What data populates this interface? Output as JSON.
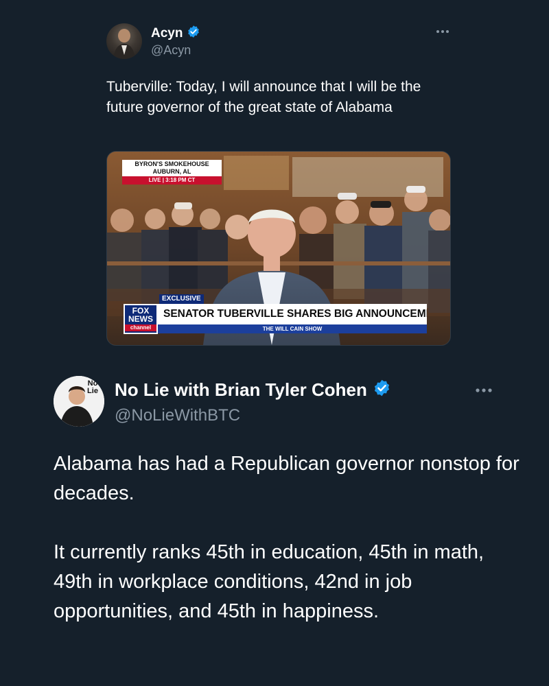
{
  "quoted_tweet": {
    "author_name": "Acyn",
    "author_handle": "@Acyn",
    "more_icon": "more-horizontal-icon",
    "verified_icon": "verified-badge-icon",
    "text": "Tuberville: Today, I will announce that I will be the future governor of the great state of Alabama",
    "media": {
      "location_line1": "BYRON'S SMOKEHOUSE",
      "location_line2": "AUBURN, AL",
      "live_label": "LIVE",
      "live_time": "3:18 PM CT",
      "exclusive_label": "EXCLUSIVE",
      "headline": "SENATOR TUBERVILLE SHARES BIG ANNOUNCEMENT",
      "show_name": "THE WILL CAIN SHOW",
      "network_logo_line1": "FOX",
      "network_logo_line2": "NEWS",
      "network_logo_line3": "channel"
    }
  },
  "main_tweet": {
    "author_name": "No Lie with Brian Tyler Cohen",
    "author_handle": "@NoLieWithBTC",
    "avatar_logo_line1": "No",
    "avatar_logo_line2": "Lie",
    "more_icon": "more-horizontal-icon",
    "verified_icon": "verified-badge-icon",
    "paragraphs": [
      "Alabama has had a Republican governor nonstop for decades.",
      "It currently ranks 45th in education, 45th in math, 49th in workplace conditions, 42nd in job opportunities, and 45th in happiness."
    ]
  },
  "colors": {
    "background": "#15202b",
    "text_primary": "#ffffff",
    "text_secondary": "#8b98a5",
    "verified_blue": "#1d9bf0",
    "fox_chyron_blue": "#0e2a78"
  }
}
